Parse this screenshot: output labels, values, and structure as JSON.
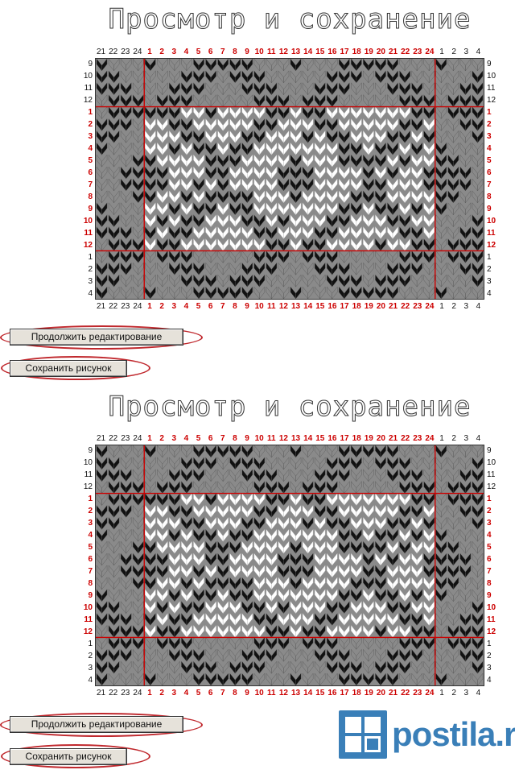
{
  "panels": [
    {
      "title": "Просмотр и сохранение",
      "col_headers": [
        "21",
        "22",
        "23",
        "24",
        "1",
        "2",
        "3",
        "4",
        "5",
        "6",
        "7",
        "8",
        "9",
        "10",
        "11",
        "12",
        "13",
        "14",
        "15",
        "16",
        "17",
        "18",
        "19",
        "20",
        "21",
        "22",
        "23",
        "24",
        "1",
        "2",
        "3",
        "4"
      ],
      "row_headers": [
        "9",
        "10",
        "11",
        "12",
        "1",
        "2",
        "3",
        "4",
        "5",
        "6",
        "7",
        "8",
        "9",
        "10",
        "11",
        "12",
        "1",
        "2",
        "3",
        "4"
      ],
      "buttons": {
        "continue_label": "Продолжить редактирование",
        "save_label": "Сохранить рисунок"
      }
    },
    {
      "title": "Просмотр и сохранение",
      "col_headers": [
        "21",
        "22",
        "23",
        "24",
        "1",
        "2",
        "3",
        "4",
        "5",
        "6",
        "7",
        "8",
        "9",
        "10",
        "11",
        "12",
        "13",
        "14",
        "15",
        "16",
        "17",
        "18",
        "19",
        "20",
        "21",
        "22",
        "23",
        "24",
        "1",
        "2",
        "3",
        "4"
      ],
      "row_headers": [
        "9",
        "10",
        "11",
        "12",
        "1",
        "2",
        "3",
        "4",
        "5",
        "6",
        "7",
        "8",
        "9",
        "10",
        "11",
        "12",
        "1",
        "2",
        "3",
        "4"
      ],
      "buttons": {
        "continue_label": "Продолжить редактирование",
        "save_label": "Сохранить рисунок"
      }
    }
  ],
  "colors": {
    "grid_line": "#cc0000",
    "highlight_text": "#cc0000",
    "stitch_dark": "#111111",
    "stitch_mid": "#8a8a8a",
    "stitch_light": "#ffffff",
    "button_oval": "#c0282d",
    "logo": "#3a7fb8"
  },
  "logo": {
    "text": "postila.ru"
  }
}
